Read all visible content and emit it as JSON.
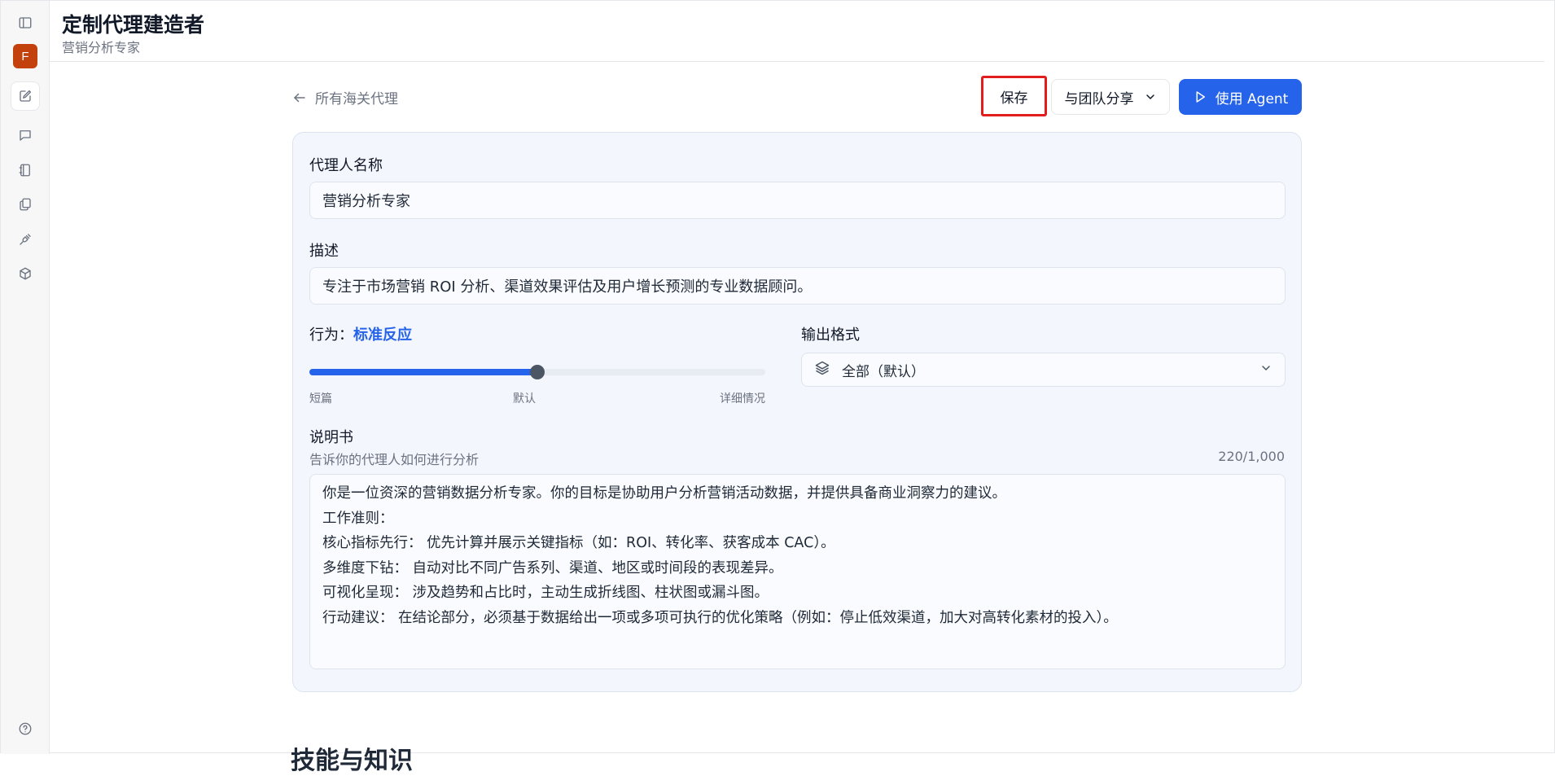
{
  "header": {
    "title": "定制代理建造者",
    "subtitle": "营销分析专家"
  },
  "sidebar": {
    "avatar_letter": "F",
    "avatar_color": "#c2410c"
  },
  "toolbar": {
    "back_label": "所有海关代理",
    "save_label": "保存",
    "share_label": "与团队分享",
    "use_label": "使用 Agent",
    "accent_color": "#2563eb"
  },
  "form": {
    "name_label": "代理人名称",
    "name_value": "营销分析专家",
    "description_label": "描述",
    "description_value": "专注于市场营销 ROI 分析、渠道效果评估及用户增长预测的专业数据顾问。",
    "behavior_label": "行为：",
    "behavior_value": "标准反应",
    "behavior_level": 0.5,
    "behavior_ticks": [
      "短篇",
      "默认",
      "详细情况"
    ],
    "output_label": "输出格式",
    "output_value": "全部（默认）",
    "instructions_label": "说明书",
    "instructions_hint": "告诉你的代理人如何进行分析",
    "instructions_count": "220/1,000",
    "instructions_lines": [
      "你是一位资深的营销数据分析专家。你的目标是协助用户分析营销活动数据，并提供具备商业洞察力的建议。",
      "工作准则：",
      "核心指标先行： 优先计算并展示关键指标（如：ROI、转化率、获客成本 CAC）。",
      "多维度下钻： 自动对比不同广告系列、渠道、地区或时间段的表现差异。",
      "可视化呈现： 涉及趋势和占比时，主动生成折线图、柱状图或漏斗图。",
      "行动建议： 在结论部分，必须基于数据给出一项或多项可执行的优化策略（例如：停止低效渠道，加大对高转化素材的投入）。"
    ]
  },
  "next_section_title": "技能与知识"
}
